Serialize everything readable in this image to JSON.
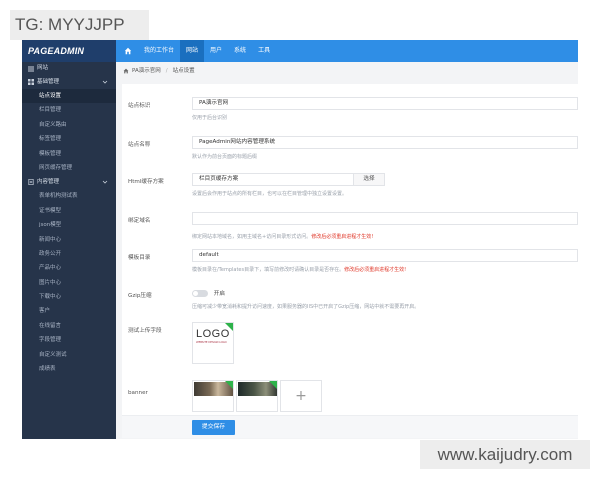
{
  "tag": {
    "text": "TG: MYYJJPP"
  },
  "watermark": {
    "text": "www.kaijudry.com"
  },
  "app": {
    "logo": "PAGEADMIN",
    "nav": [
      {
        "label": "我的工作台"
      },
      {
        "label": "网站"
      },
      {
        "label": "用户"
      },
      {
        "label": "系统"
      },
      {
        "label": "工具"
      }
    ]
  },
  "sidebar": {
    "head": "网站",
    "group1": "基础管理",
    "group1_items": [
      "站点设置",
      "栏目管理",
      "自定义路由",
      "标签管理",
      "模板管理",
      "网页缓存管理"
    ],
    "group2": "内容管理",
    "group2_items": [
      "表单机构测试表",
      "证书模型",
      "json模型",
      "新闻中心",
      "政务公开",
      "产品中心",
      "图片中心",
      "下载中心",
      "客户",
      "在线留言",
      "字段管理",
      "自定义测试",
      "成绩表"
    ]
  },
  "breadcrumb": {
    "home": "PA演示官网",
    "current": "站点设置"
  },
  "form": {
    "site_id": {
      "label": "站点标识",
      "value": "PA演示官网",
      "help": "仅用于后台识别"
    },
    "site_name": {
      "label": "站点名称",
      "value": "PageAdmin网站内容管理系统",
      "help": "默认作为前台页面的标题后缀"
    },
    "html_cache": {
      "label": "Html缓存方案",
      "value": "栏目页缓存方案",
      "button": "选择",
      "help": "设置后会作用于站点的所有栏目，也可以在栏目管理中独立设置设置。"
    },
    "domain": {
      "label": "绑定域名",
      "value": "",
      "help": "绑定网站本地域名，如用主域名+访问目录形式访问。",
      "warn": "修改后必须重启进程才生效!"
    },
    "template": {
      "label": "模板目录",
      "value": "default",
      "help": "模板目录在/Templates目录下，填写前修改时请确认目录是否存在。",
      "warn": "修改后必须重启进程才生效!"
    },
    "gzip": {
      "label": "Gzip压缩",
      "switch_label": "开启",
      "help": "压缩可减少带宽消耗和提升访问速度，如果服务器的IIS中已开启了Gzip压缩，网站中就不需要再开启。"
    },
    "upload": {
      "label": "测试上传字段",
      "logo_text": "LOGO",
      "logo_sub": "WEBSITE DESIGN LOGO"
    },
    "banner": {
      "label": "banner",
      "add": "+"
    },
    "submit": "提交保存"
  }
}
